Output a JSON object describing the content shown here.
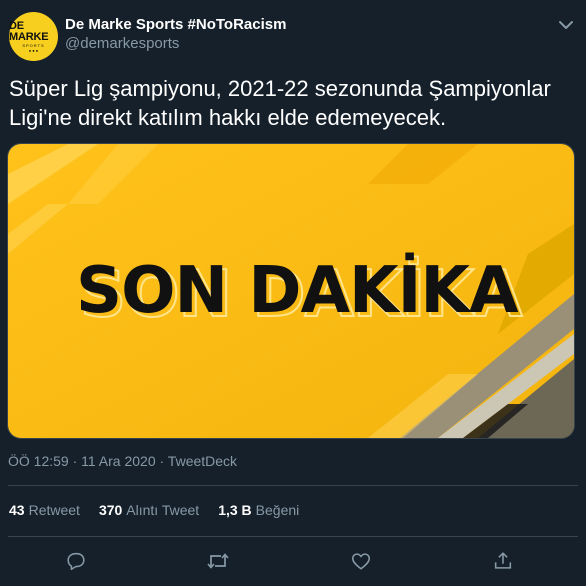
{
  "tweet": {
    "display_name": "De Marke Sports #NoToRacism",
    "handle": "@demarkesports",
    "avatar_text": "DE MARKE",
    "avatar_subtext": "SPORTS",
    "text": "Süper Lig şampiyonu, 2021-22 sezonunda Şampiyonlar Ligi'ne direkt katılım hakkı elde edemeyecek.",
    "image_text": "SON DAKİKA",
    "meta": "ÖÖ 12:59 · 11 Ara 2020 · TweetDeck"
  },
  "stats": {
    "retweets_count": "43",
    "retweets_label": "Retweet",
    "quotes_count": "370",
    "quotes_label": "Alıntı Tweet",
    "likes_count": "1,3 B",
    "likes_label": "Beğeni"
  },
  "icons": {
    "reply": "reply-icon",
    "retweet": "retweet-icon",
    "like": "heart-icon",
    "share": "share-icon",
    "more": "chevron-down-icon"
  },
  "colors": {
    "background": "#15202b",
    "secondary_text": "#8899a6",
    "divider": "#38444d",
    "image_yellow": "#f7bd14",
    "avatar_yellow": "#f6cf1f"
  }
}
